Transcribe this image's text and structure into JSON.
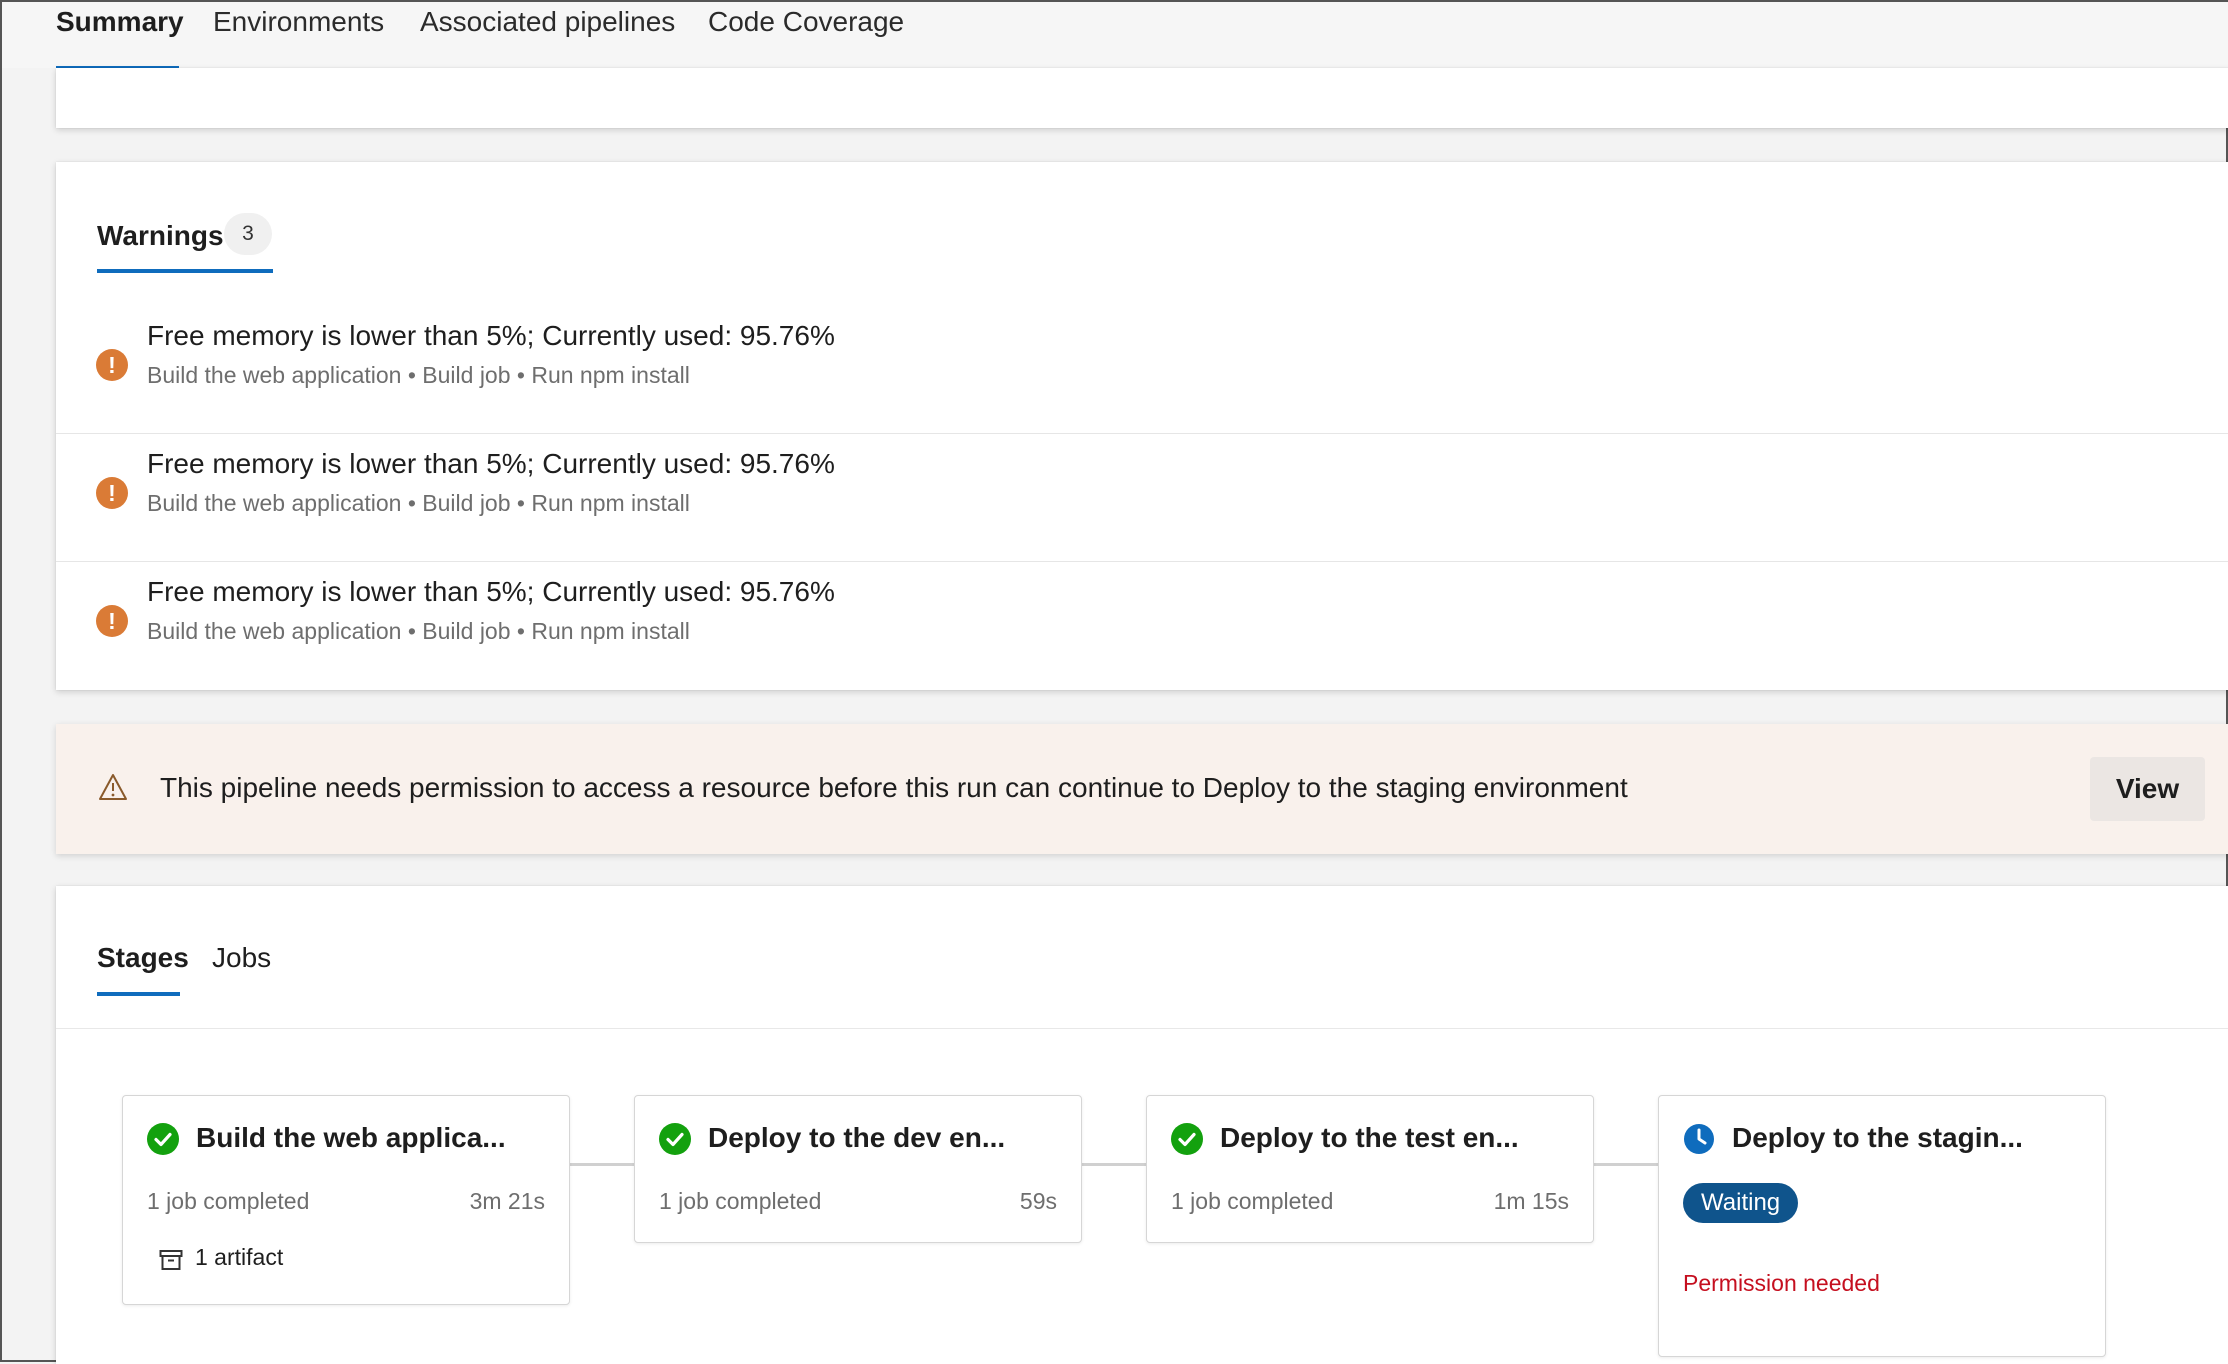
{
  "top_tabs": [
    {
      "label": "Summary",
      "active": true
    },
    {
      "label": "Environments",
      "active": false
    },
    {
      "label": "Associated pipelines",
      "active": false
    },
    {
      "label": "Code Coverage",
      "active": false
    }
  ],
  "warnings": {
    "heading": "Warnings",
    "count": "3",
    "items": [
      {
        "message": "Free memory is lower than 5%; Currently used: 95.76%",
        "path": "Build the web application • Build job • Run npm install"
      },
      {
        "message": "Free memory is lower than 5%; Currently used: 95.76%",
        "path": "Build the web application • Build job • Run npm install"
      },
      {
        "message": "Free memory is lower than 5%; Currently used: 95.76%",
        "path": "Build the web application • Build job • Run npm install"
      }
    ]
  },
  "permission_banner": {
    "icon": "warning-triangle-icon",
    "text": "This pipeline needs permission to access a resource before this run can continue to Deploy to the staging environment",
    "button_label": "View"
  },
  "stages_section": {
    "tabs": [
      {
        "label": "Stages",
        "active": true
      },
      {
        "label": "Jobs",
        "active": false
      }
    ],
    "stages": [
      {
        "title": "Build the web applica...",
        "status": "succeeded",
        "icon": "check-circle-icon",
        "meta": "1 job completed",
        "duration": "3m 21s",
        "artifact": "1 artifact"
      },
      {
        "title": "Deploy to the dev en...",
        "status": "succeeded",
        "icon": "check-circle-icon",
        "meta": "1 job completed",
        "duration": "59s"
      },
      {
        "title": "Deploy to the test en...",
        "status": "succeeded",
        "icon": "check-circle-icon",
        "meta": "1 job completed",
        "duration": "1m 15s"
      },
      {
        "title": "Deploy to the stagin...",
        "status": "waiting",
        "icon": "clock-icon",
        "badge": "Waiting",
        "note": "Permission needed"
      }
    ]
  },
  "colors": {
    "accent": "#0f6cbd",
    "warning": "#da7b36",
    "success": "#13a10e",
    "waiting_badge": "#0f548c",
    "error_text": "#c50f1f",
    "banner_bg": "#f9f1ec"
  }
}
